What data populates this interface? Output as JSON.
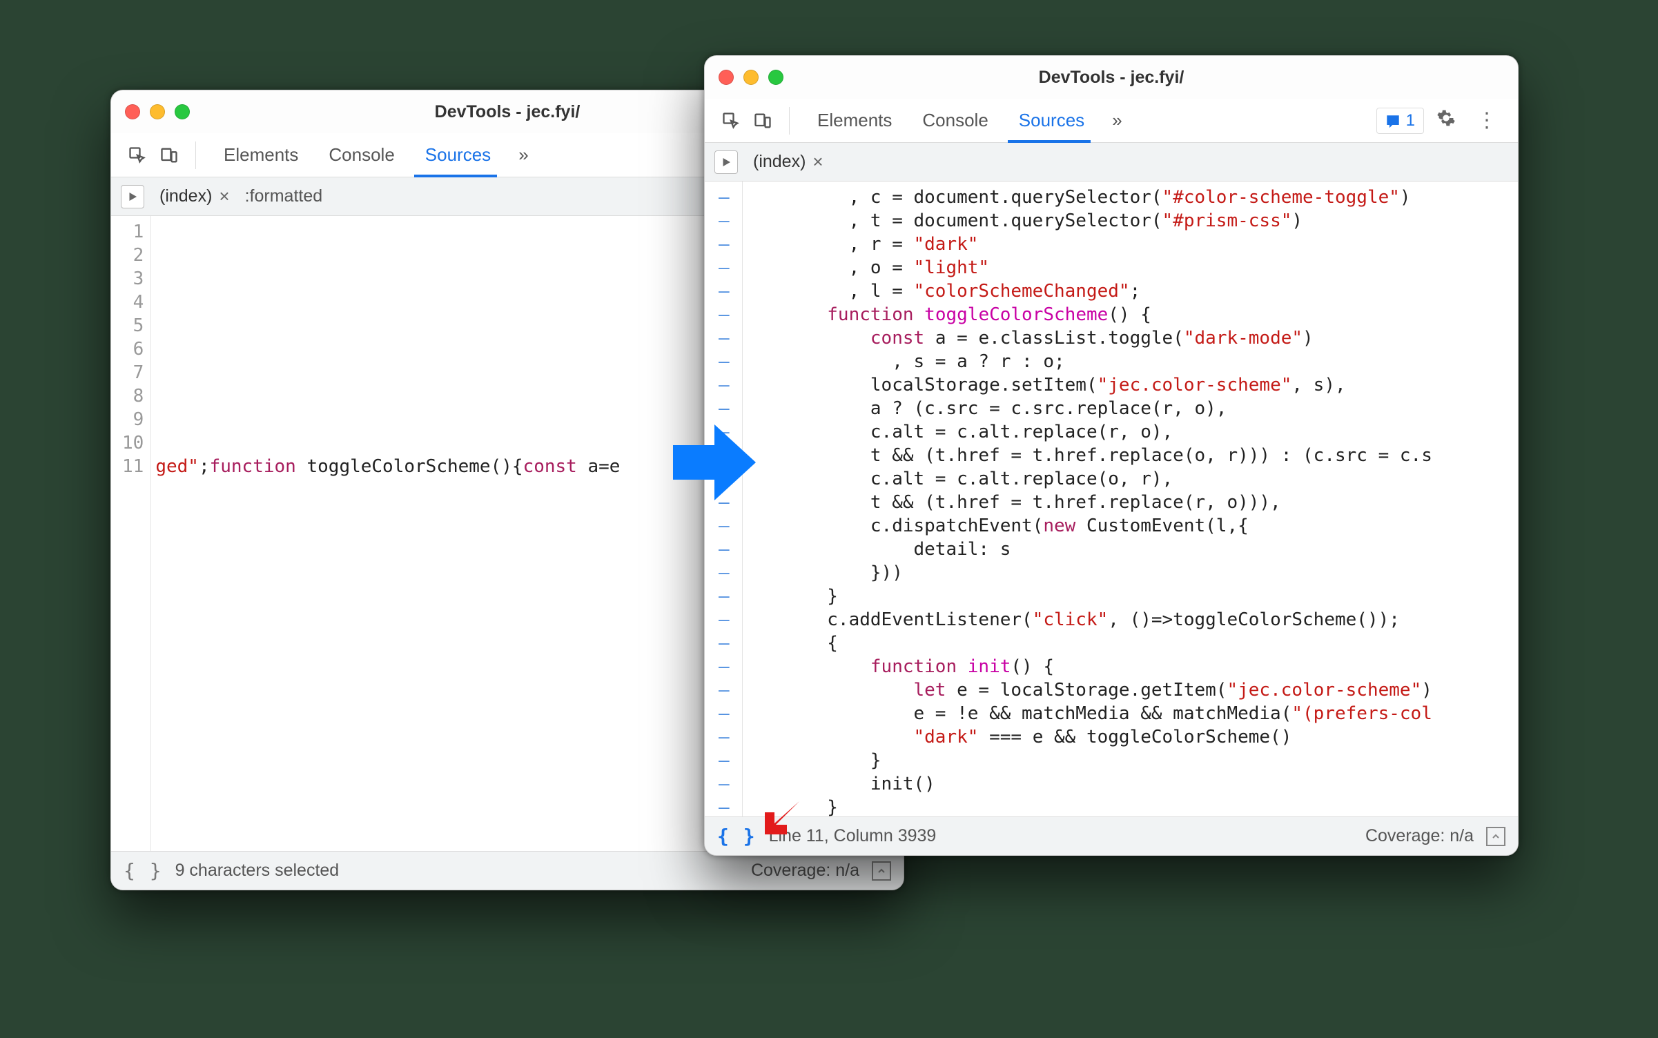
{
  "annotations": {
    "blue_arrow": "right-arrow",
    "red_arrow": "down-left-arrow"
  },
  "left_window": {
    "title": "DevTools - jec.fyi/",
    "toolbar_tabs": [
      "Elements",
      "Console",
      "Sources"
    ],
    "active_tab": "Sources",
    "more_tabs_glyph": "»",
    "file_tabs": {
      "index_label": "(index)",
      "formatted_label": ":formatted"
    },
    "gutter_lines": [
      "1",
      "2",
      "3",
      "4",
      "5",
      "6",
      "7",
      "8",
      "9",
      "10",
      "11"
    ],
    "code_line11_frag1": "ged\"",
    "code_line11_frag2": ";",
    "code_line11_kw1": "function",
    "code_line11_fn": " toggleColorScheme",
    "code_line11_frag3": "(){",
    "code_line11_kw2": "const",
    "code_line11_frag4": " a=e",
    "status": {
      "pretty_label": "{ }",
      "selection": "9 characters selected",
      "coverage": "Coverage: n/a"
    }
  },
  "right_window": {
    "title": "DevTools - jec.fyi/",
    "toolbar_tabs": [
      "Elements",
      "Console",
      "Sources"
    ],
    "active_tab": "Sources",
    "more_tabs_glyph": "»",
    "issues_count": "1",
    "file_tabs": {
      "index_label": "(index)"
    },
    "gutter_dash": "–",
    "code_lines": [
      [
        {
          "t": "      , c = document.querySelector("
        },
        {
          "t": "\"#color-scheme-toggle\"",
          "c": "str"
        },
        {
          "t": ")"
        }
      ],
      [
        {
          "t": "      , t = document.querySelector("
        },
        {
          "t": "\"#prism-css\"",
          "c": "str"
        },
        {
          "t": ")"
        }
      ],
      [
        {
          "t": "      , r = "
        },
        {
          "t": "\"dark\"",
          "c": "str"
        }
      ],
      [
        {
          "t": "      , o = "
        },
        {
          "t": "\"light\"",
          "c": "str"
        }
      ],
      [
        {
          "t": "      , l = "
        },
        {
          "t": "\"colorSchemeChanged\"",
          "c": "str"
        },
        {
          "t": ";"
        }
      ],
      [
        {
          "t": "    ",
          "c": ""
        },
        {
          "t": "function",
          "c": "kw"
        },
        {
          "t": " "
        },
        {
          "t": "toggleColorScheme",
          "c": "fname"
        },
        {
          "t": "() {"
        }
      ],
      [
        {
          "t": "        "
        },
        {
          "t": "const",
          "c": "kw"
        },
        {
          "t": " a = e.classList.toggle("
        },
        {
          "t": "\"dark-mode\"",
          "c": "str"
        },
        {
          "t": ")"
        }
      ],
      [
        {
          "t": "          , s = a ? r : o;"
        }
      ],
      [
        {
          "t": "        localStorage.setItem("
        },
        {
          "t": "\"jec.color-scheme\"",
          "c": "str"
        },
        {
          "t": ", s),"
        }
      ],
      [
        {
          "t": "        a ? (c.src = c.src.replace(r, o),"
        }
      ],
      [
        {
          "t": "        c.alt = c.alt.replace(r, o),"
        }
      ],
      [
        {
          "t": "        t && (t.href = t.href.replace(o, r))) : (c.src = c.s"
        }
      ],
      [
        {
          "t": "        c.alt = c.alt.replace(o, r),"
        }
      ],
      [
        {
          "t": "        t && (t.href = t.href.replace(r, o))),"
        }
      ],
      [
        {
          "t": "        c.dispatchEvent("
        },
        {
          "t": "new",
          "c": "kw"
        },
        {
          "t": " CustomEvent(l,{"
        }
      ],
      [
        {
          "t": "            detail: s"
        }
      ],
      [
        {
          "t": "        }))"
        }
      ],
      [
        {
          "t": "    }"
        }
      ],
      [
        {
          "t": "    c.addEventListener("
        },
        {
          "t": "\"click\"",
          "c": "str"
        },
        {
          "t": ", ()=>toggleColorScheme());"
        }
      ],
      [
        {
          "t": "    {"
        }
      ],
      [
        {
          "t": "        "
        },
        {
          "t": "function",
          "c": "kw"
        },
        {
          "t": " "
        },
        {
          "t": "init",
          "c": "fname"
        },
        {
          "t": "() {"
        }
      ],
      [
        {
          "t": "            "
        },
        {
          "t": "let",
          "c": "kw"
        },
        {
          "t": " e = localStorage.getItem("
        },
        {
          "t": "\"jec.color-scheme\"",
          "c": "str"
        },
        {
          "t": ")"
        }
      ],
      [
        {
          "t": "            e = !e && matchMedia && matchMedia("
        },
        {
          "t": "\"(prefers-col",
          "c": "str"
        }
      ],
      [
        {
          "t": "            "
        },
        {
          "t": "\"dark\"",
          "c": "str"
        },
        {
          "t": " === e && toggleColorScheme()"
        }
      ],
      [
        {
          "t": "        }"
        }
      ],
      [
        {
          "t": "        init()"
        }
      ],
      [
        {
          "t": "    }"
        }
      ],
      [
        {
          "t": "}"
        }
      ]
    ],
    "status": {
      "pretty_label": "{ }",
      "cursor": "Line 11, Column 3939",
      "coverage": "Coverage: n/a"
    }
  }
}
